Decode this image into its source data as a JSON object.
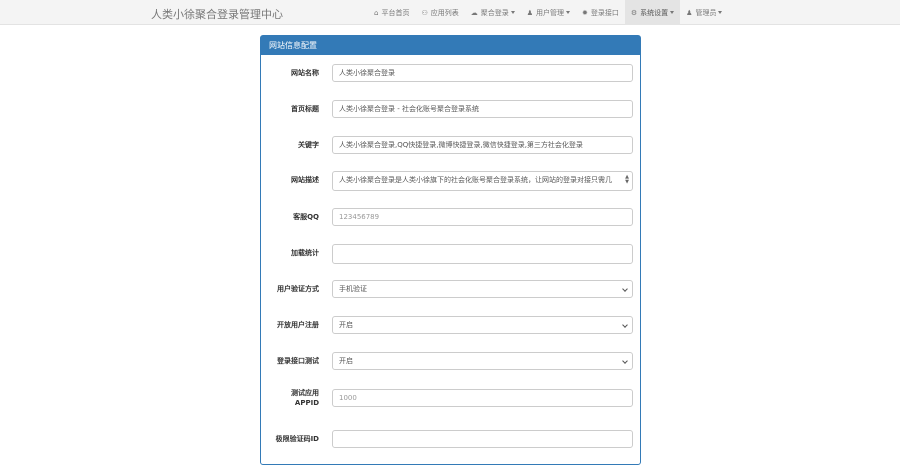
{
  "navbar": {
    "brand": "人类小徐聚合登录管理中心",
    "items": [
      {
        "label": "平台首页",
        "icon": "home-icon",
        "glyph": "⌂"
      },
      {
        "label": "应用列表",
        "icon": "group-icon",
        "glyph": "⚇"
      },
      {
        "label": "聚合登录",
        "icon": "cloud-icon",
        "glyph": "☁"
      },
      {
        "label": "用户管理",
        "icon": "user-icon",
        "glyph": "♟"
      },
      {
        "label": "登录接口",
        "icon": "gear-icon",
        "glyph": "✹"
      },
      {
        "label": "系统设置",
        "icon": "cog-icon",
        "glyph": "⚙"
      },
      {
        "label": "管理员",
        "icon": "user-icon",
        "glyph": "♟"
      }
    ]
  },
  "panel": {
    "title": "网站信息配置",
    "fields": {
      "site_name": {
        "label": "网站名称",
        "value": "人类小徐聚合登录"
      },
      "home_title": {
        "label": "首页标题",
        "value": "人类小徐聚合登录 - 社会化账号聚合登录系统"
      },
      "keywords": {
        "label": "关键字",
        "value": "人类小徐聚合登录,QQ快捷登录,微博快捷登录,微信快捷登录,第三方社会化登录"
      },
      "description": {
        "label": "网站描述",
        "value": "人类小徐聚合登录是人类小徐旗下的社会化账号聚合登录系统，让网站的登录对接只需几"
      },
      "qq": {
        "label": "客服QQ",
        "value": "123456789"
      },
      "stats_code": {
        "label": "加载统计",
        "value": ""
      },
      "verify_method": {
        "label": "用户验证方式",
        "value": "手机验证"
      },
      "open_register": {
        "label": "开放用户注册",
        "value": "开启"
      },
      "api_test": {
        "label": "登录接口测试",
        "value": "开启"
      },
      "test_appid": {
        "label_line1": "测试应用",
        "label_line2": "APPID",
        "value": "1000"
      },
      "captcha_id": {
        "label": "极限验证码ID",
        "value": ""
      }
    }
  },
  "colors": {
    "panel_primary": "#337ab7",
    "navbar_bg": "#f4f4f4"
  }
}
